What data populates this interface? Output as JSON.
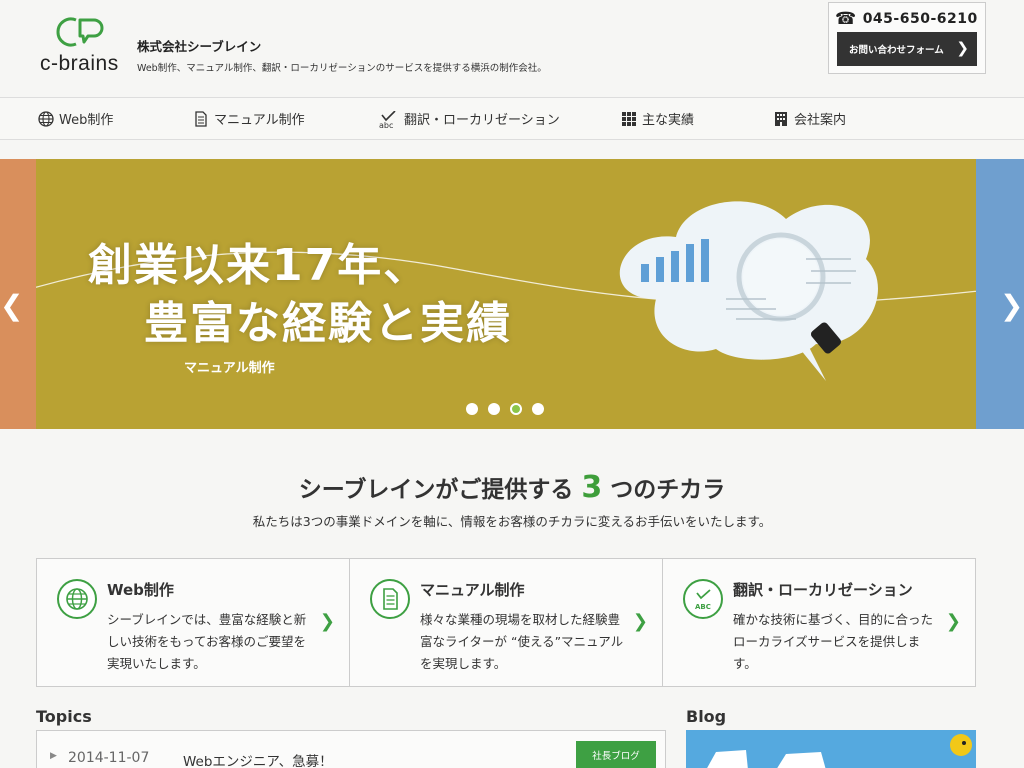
{
  "header": {
    "logo_text": "c-brains",
    "company_name": "株式会社シーブレイン",
    "tagline": "Web制作、マニュアル制作、翻訳・ローカリゼーションのサービスを提供する横浜の制作会社。",
    "phone": "045-650-6210",
    "contact_button": "お問い合わせフォーム"
  },
  "nav": {
    "items": [
      {
        "label": "Web制作",
        "icon": "globe-icon"
      },
      {
        "label": "マニュアル制作",
        "icon": "document-icon"
      },
      {
        "label": "翻訳・ローカリゼーション",
        "icon": "abc-check-icon"
      },
      {
        "label": "主な実績",
        "icon": "grid-icon"
      },
      {
        "label": "会社案内",
        "icon": "building-icon"
      }
    ]
  },
  "hero": {
    "line1": "創業以来17年、",
    "line2": "豊富な経験と実績",
    "caption": "マニュアル制作",
    "slide_count": 4,
    "active_slide": 3
  },
  "services": {
    "title_before": "シーブレインがご提供する",
    "title_num": "3",
    "title_after": "つのチカラ",
    "subtitle": "私たちは3つの事業ドメインを軸に、情報をお客様のチカラに変えるお手伝いをいたします。",
    "cards": [
      {
        "title": "Web制作",
        "icon": "globe-icon",
        "text": "シーブレインでは、豊富な経験と新しい技術をもってお客様のご要望を実現いたします。"
      },
      {
        "title": "マニュアル制作",
        "icon": "document-icon",
        "text": "様々な業種の現場を取材した経験豊富なライターが “使える”マニュアルを実現します。"
      },
      {
        "title": "翻訳・ローカリゼーション",
        "icon": "abc-check-icon",
        "text": "確かな技術に基づく、目的に合ったローカライズサービスを提供します。"
      }
    ]
  },
  "topics": {
    "heading": "Topics",
    "items": [
      {
        "date": "2014-11-07",
        "title": "Webエンジニア、急募！",
        "badge": "社長ブログ"
      }
    ]
  },
  "blog": {
    "heading": "Blog"
  },
  "colors": {
    "accent_green": "#3ea043",
    "hero_yellow": "#b9a233"
  }
}
